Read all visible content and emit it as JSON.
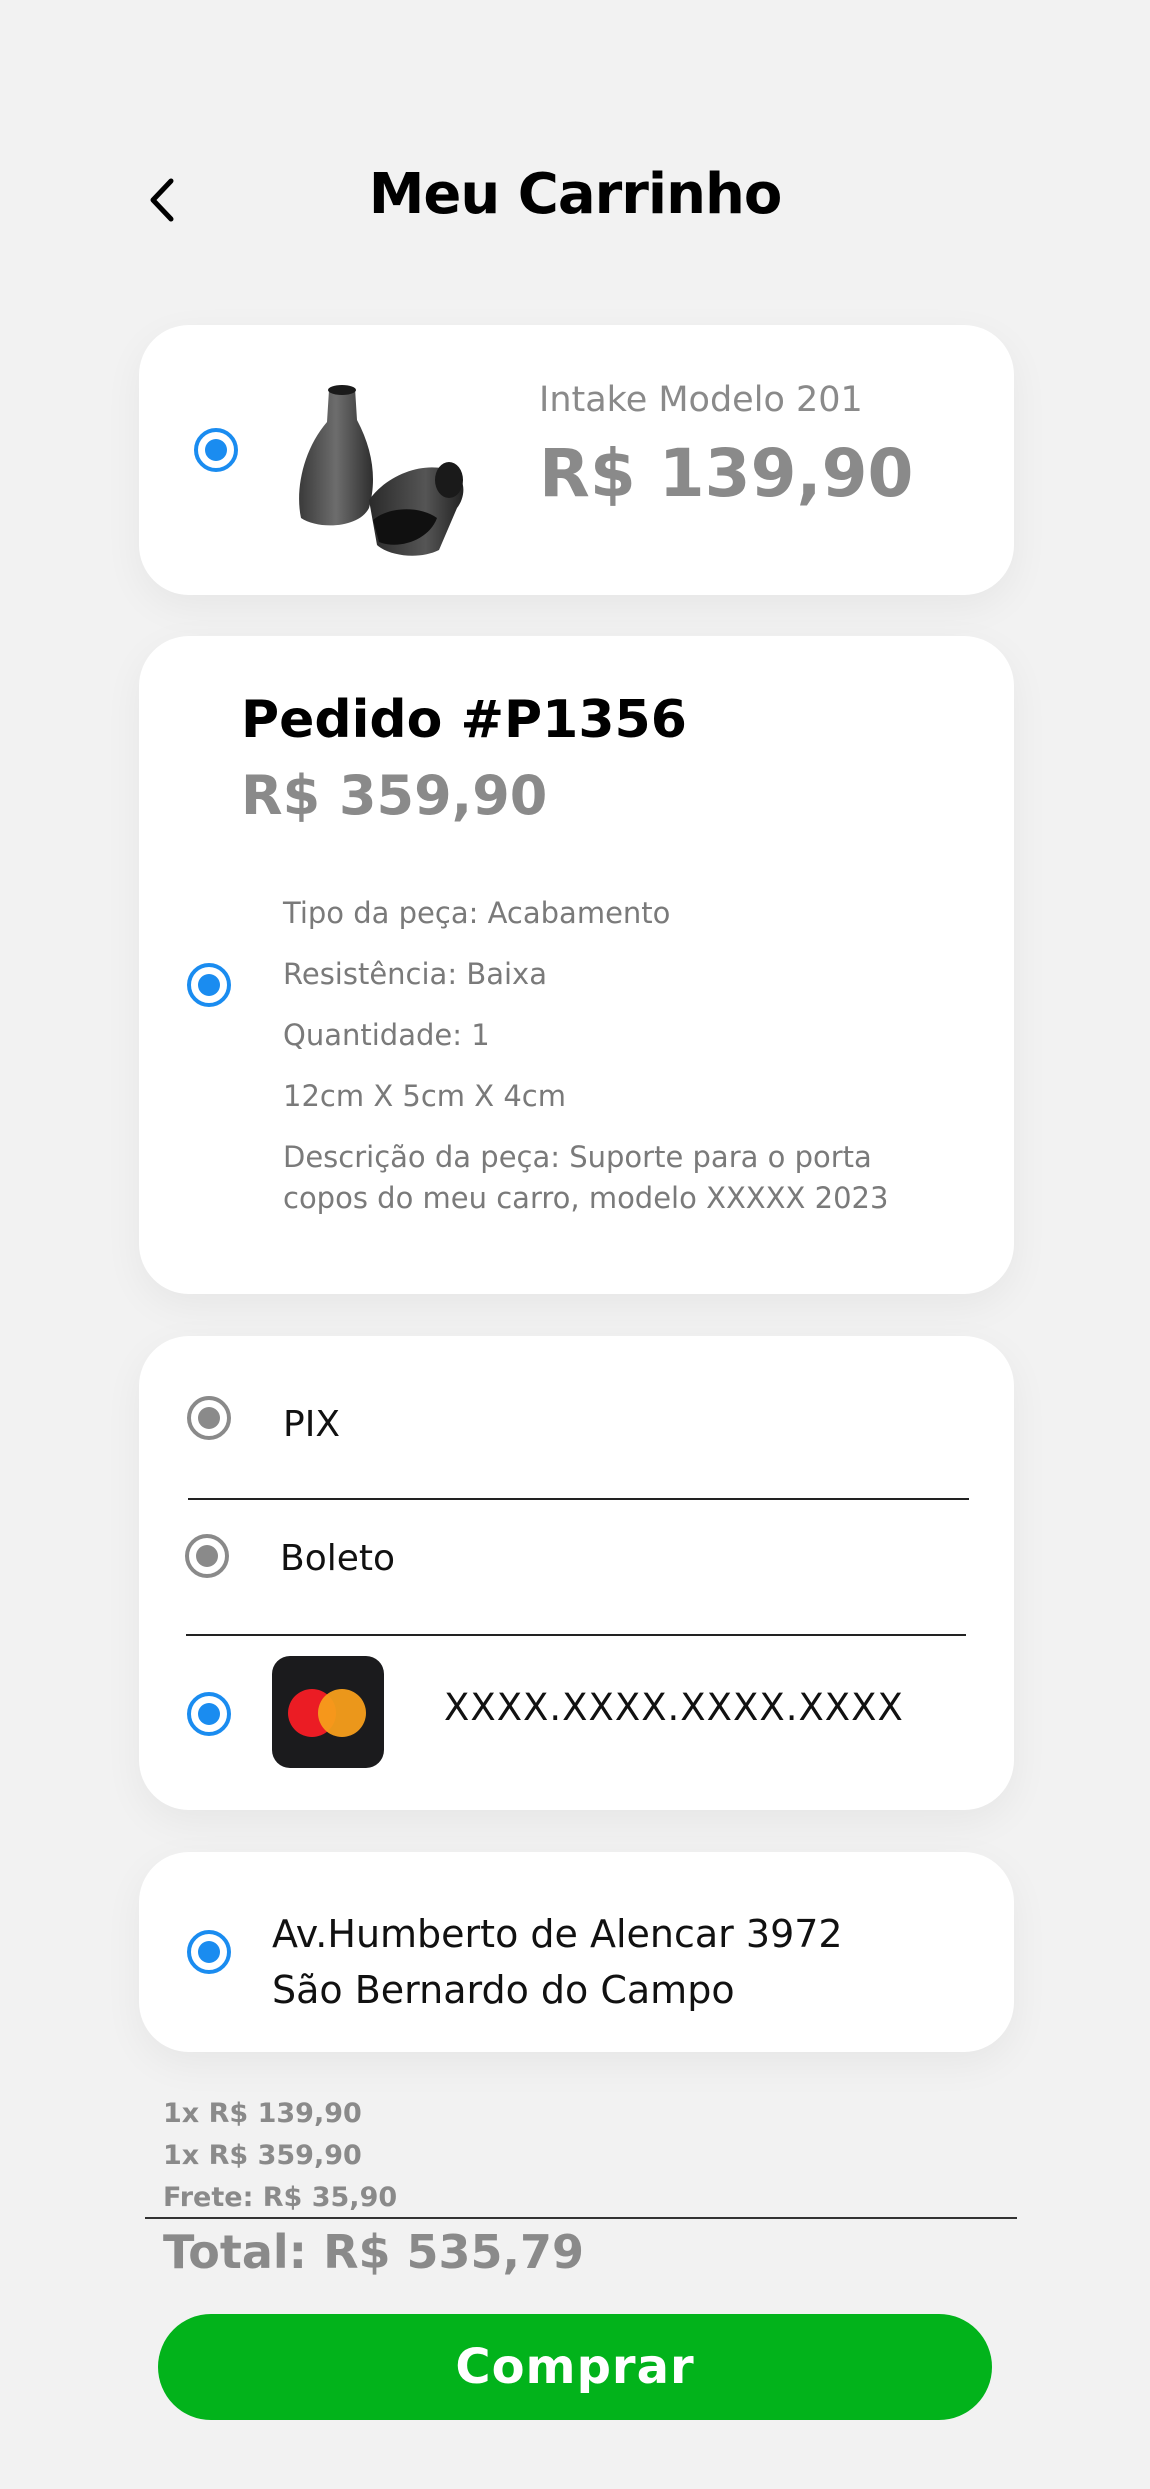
{
  "header": {
    "title": "Meu Carrinho",
    "back_icon": "chevron-left-icon"
  },
  "cart_item": {
    "name": "Intake Modelo 201",
    "price": "R$ 139,90",
    "selected": true
  },
  "order": {
    "title": "Pedido #P1356",
    "price": "R$ 359,90",
    "selected": true,
    "details": [
      "Tipo da peça: Acabamento",
      "Resistência: Baixa",
      "Quantidade: 1",
      "12cm X 5cm X 4cm",
      "Descrição da peça: Suporte para o porta",
      "copos do meu carro, modelo XXXXX 2023"
    ]
  },
  "payment": {
    "options": [
      {
        "label": "PIX",
        "selected": false
      },
      {
        "label": "Boleto",
        "selected": false
      },
      {
        "label": "XXXX.XXXX.XXXX.XXXX",
        "selected": true,
        "icon": "mastercard-icon"
      }
    ]
  },
  "address": {
    "line1": "Av.Humberto de Alencar 3972",
    "line2": "São Bernardo do Campo",
    "selected": true
  },
  "summary": {
    "item1": "1x R$ 139,90",
    "item2": "1x R$ 359,90",
    "shipping": "Frete: R$ 35,90",
    "total": "Total: R$ 535,79"
  },
  "buy_button": {
    "label": "Comprar"
  },
  "colors": {
    "background": "#f2f2f2",
    "accent_blue": "#1a8cf0",
    "buy_green": "#02b31b",
    "muted_text": "#8a8a8a"
  }
}
